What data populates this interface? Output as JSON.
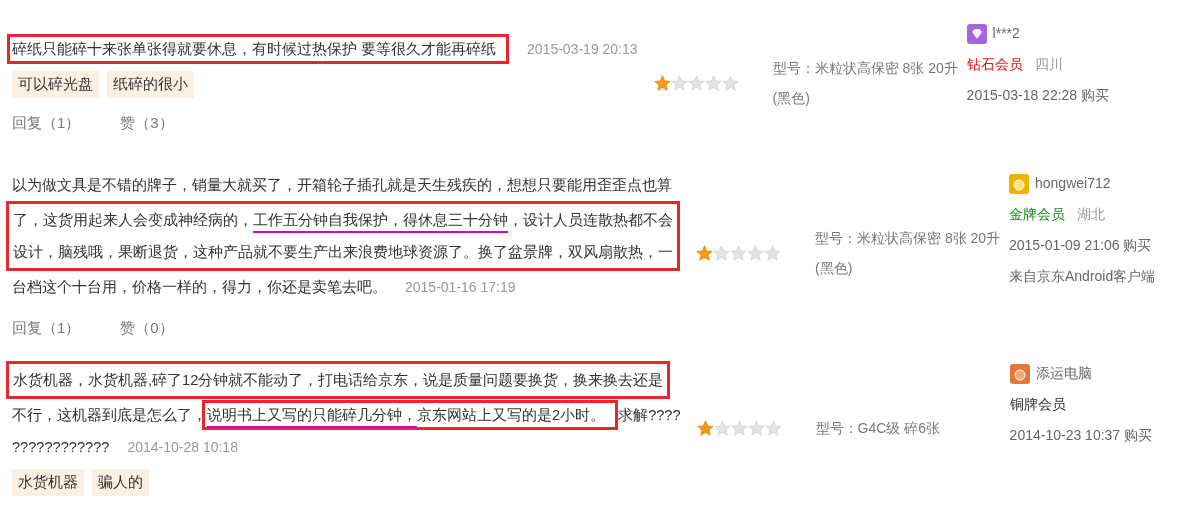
{
  "reviews": [
    {
      "rows": [
        {
          "boxed": false,
          "segments": [
            {
              "boxed": true,
              "parts": [
                {
                  "text": "碎纸只能碎十来张单张得就要休息，有时候过热保护 要等很久才能再碎纸",
                  "underlined": false
                }
              ]
            }
          ]
        }
      ],
      "date": "2015-03-19 20:13",
      "tags": [
        "可以碎光盘",
        "纸碎的很小"
      ],
      "actions": [
        "回复（1）",
        "赞（3）"
      ],
      "stars": 1,
      "model": "型号：米粒状高保密 8张 20升(黑色)",
      "user": {
        "kind": "diamond",
        "name": "l***2",
        "level": "钻石会员",
        "color": "#e4141b",
        "region": "四川",
        "purchase_time": "2015-03-18 22:28 购买"
      }
    },
    {
      "rows": [
        {
          "boxed": false,
          "segments": [
            {
              "boxed": false,
              "parts": [
                {
                  "text": "以为做文具是不错的牌子，销量大就买了，开箱轮子插孔就是天生残疾的，想想只要能用歪歪点也算",
                  "underlined": false
                }
              ]
            }
          ]
        },
        {
          "boxed": true,
          "segments": [
            {
              "boxed": false,
              "parts": [
                {
                  "text": "了，这货用起来人会变成神经病的，",
                  "underlined": false
                },
                {
                  "text": "工作五分钟自我保护，得休息三十分钟",
                  "underlined": true
                },
                {
                  "text": "，设计人员连散热都不会",
                  "underlined": false
                }
              ]
            }
          ]
        },
        {
          "boxed": true,
          "segments": [
            {
              "boxed": false,
              "parts": [
                {
                  "text": "设计，脑残哦，果断退货，这种产品就不要生产出来浪费地球资源了。换了盆景牌，双风扇散热，一",
                  "underlined": false
                }
              ]
            }
          ]
        },
        {
          "boxed": false,
          "segments": [
            {
              "boxed": false,
              "parts": [
                {
                  "text": "台档这个十台用，价格一样的，得力，你还是卖笔去吧。",
                  "underlined": false
                }
              ]
            }
          ]
        }
      ],
      "date": "2015-01-16 17:19",
      "actions": [
        "回复（1）",
        "赞（0）"
      ],
      "stars": 1,
      "model": "型号：米粒状高保密 8张 20升(黑色)",
      "user": {
        "kind": "gold",
        "name": "hongwei712",
        "level": "金牌会员",
        "color": "#1a8a1a",
        "region": "湖北",
        "purchase_time": "2015-01-09 21:06 购买",
        "source": "来自京东Android客户端"
      }
    },
    {
      "rows": [
        {
          "boxed": true,
          "segments": [
            {
              "boxed": false,
              "parts": [
                {
                  "text": "水货机器，水货机器,碎了12分钟就不能动了，打电话给京东，说是质量问题要换货，换来换去还是",
                  "underlined": false
                }
              ]
            }
          ]
        },
        {
          "boxed": false,
          "segments": [
            {
              "boxed": false,
              "parts": [
                {
                  "text": "不行，这机器到底是怎么了，",
                  "underlined": false
                }
              ]
            },
            {
              "boxed": true,
              "parts": [
                {
                  "text": "说明书上又写的只能碎几分钟，",
                  "underlined": true
                },
                {
                  "text": "京东网站上又写的是2小时。",
                  "underlined": false
                }
              ]
            },
            {
              "boxed": false,
              "parts": [
                {
                  "text": "求解????",
                  "underlined": false
                }
              ]
            }
          ]
        },
        {
          "boxed": false,
          "segments": [
            {
              "boxed": false,
              "parts": [
                {
                  "text": "????????????",
                  "underlined": false
                }
              ]
            }
          ]
        }
      ],
      "date": "2014-10-28 10:18",
      "tags": [
        "水货机器",
        "骗人的"
      ],
      "stars": 1,
      "model": "型号：G4C级 碎6张",
      "user": {
        "kind": "copper",
        "name": "添运电脑",
        "level": "铜牌会员",
        "color": "#333333",
        "purchase_time": "2014-10-23 10:37 购买"
      }
    }
  ]
}
